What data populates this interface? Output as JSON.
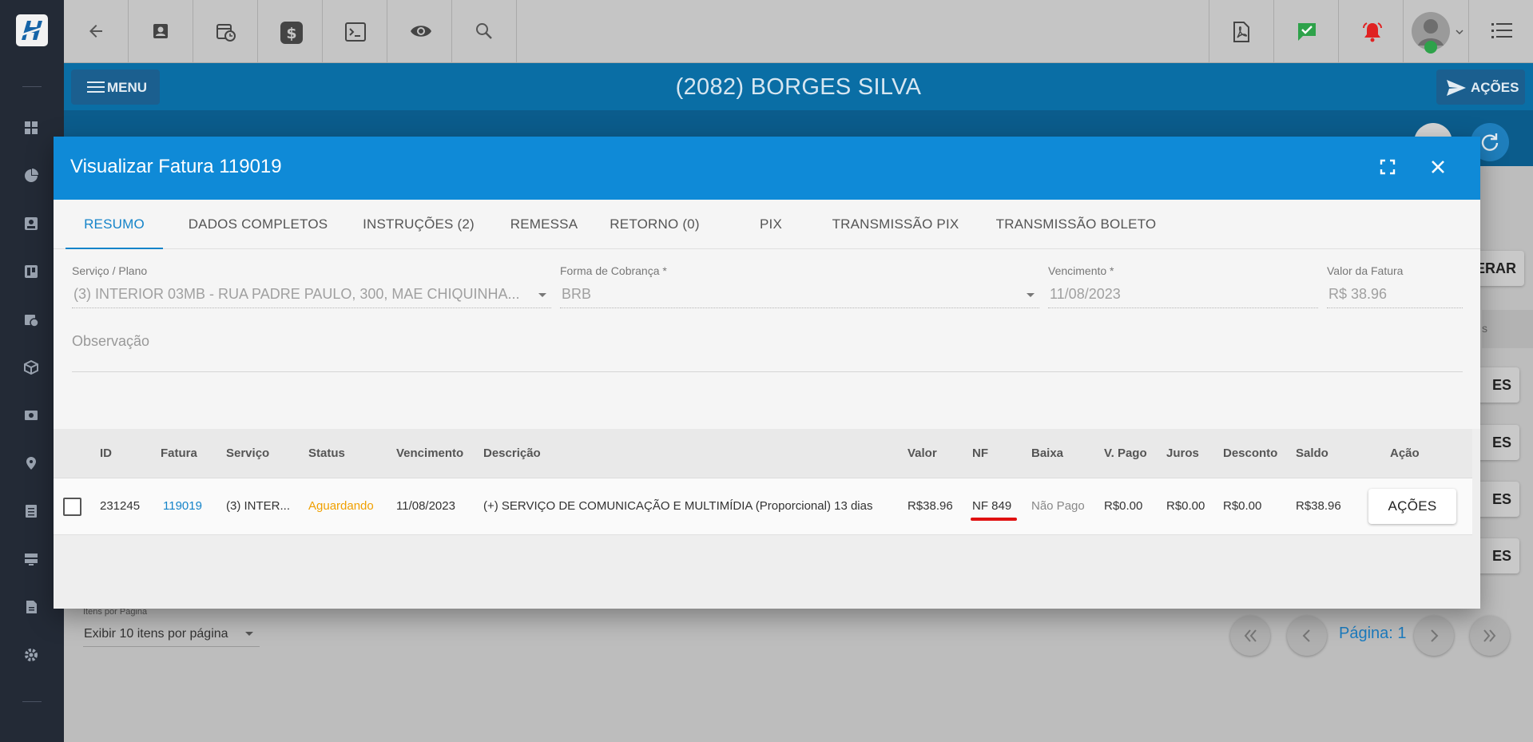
{
  "colors": {
    "modal_header": "#0f8ad7",
    "accent": "#1584c9",
    "status_pending": "#f0a000",
    "sidebar_bg": "#232a36",
    "highlight_mark": "#e01010"
  },
  "header": {
    "menu_label": "MENU",
    "client_title": "(2082) BORGES SILVA",
    "acoes_label": "AÇÕES"
  },
  "toolbar": {
    "left_icons": [
      "back-arrow-icon",
      "contact-card-icon",
      "calendar-clock-icon",
      "dollar-icon",
      "terminal-icon",
      "eye-icon",
      "search-icon"
    ],
    "right_icons": [
      "pdf-icon",
      "chat-check-icon",
      "alarm-bell-icon",
      "user-avatar",
      "list-icon"
    ]
  },
  "background": {
    "gerar_partial": "ERAR",
    "band_partial": "s",
    "es_partial": "ES",
    "per_page_label": "Itens por Página",
    "per_page_value": "Exibir 10 itens por página",
    "page_label": "Página: 1"
  },
  "modal": {
    "title": "Visualizar Fatura 119019",
    "tabs": [
      {
        "label": "RESUMO",
        "active": true
      },
      {
        "label": "DADOS COMPLETOS"
      },
      {
        "label": "INSTRUÇÕES (2)"
      },
      {
        "label": "REMESSA"
      },
      {
        "label": "RETORNO (0)"
      },
      {
        "label": "PIX"
      },
      {
        "label": "TRANSMISSÃO PIX"
      },
      {
        "label": "TRANSMISSÃO BOLETO"
      }
    ],
    "form": {
      "servico_label": "Serviço / Plano",
      "servico_value": "(3) INTERIOR 03MB - RUA PADRE PAULO, 300, MAE CHIQUINHA...",
      "forma_label": "Forma de Cobrança *",
      "forma_value": "BRB",
      "vencimento_label": "Vencimento *",
      "vencimento_value": "11/08/2023",
      "valor_label": "Valor da Fatura",
      "valor_value": "R$ 38.96",
      "observacao_label": "Observação"
    },
    "table": {
      "headers": [
        "ID",
        "Fatura",
        "Serviço",
        "Status",
        "Vencimento",
        "Descrição",
        "Valor",
        "NF",
        "Baixa",
        "V. Pago",
        "Juros",
        "Desconto",
        "Saldo",
        "Ação"
      ],
      "rows": [
        {
          "id": "231245",
          "fatura": "119019",
          "servico": "(3) INTER...",
          "status": "Aguardando",
          "vencimento": "11/08/2023",
          "descricao": "(+) SERVIÇO DE COMUNICAÇÃO E MULTIMÍDIA (Proporcional) 13 dias",
          "valor": "R$38.96",
          "nf": "NF 849",
          "baixa": "Não Pago",
          "v_pago": "R$0.00",
          "juros": "R$0.00",
          "desconto": "R$0.00",
          "saldo": "R$38.96",
          "acao": "AÇÕES"
        }
      ]
    }
  }
}
